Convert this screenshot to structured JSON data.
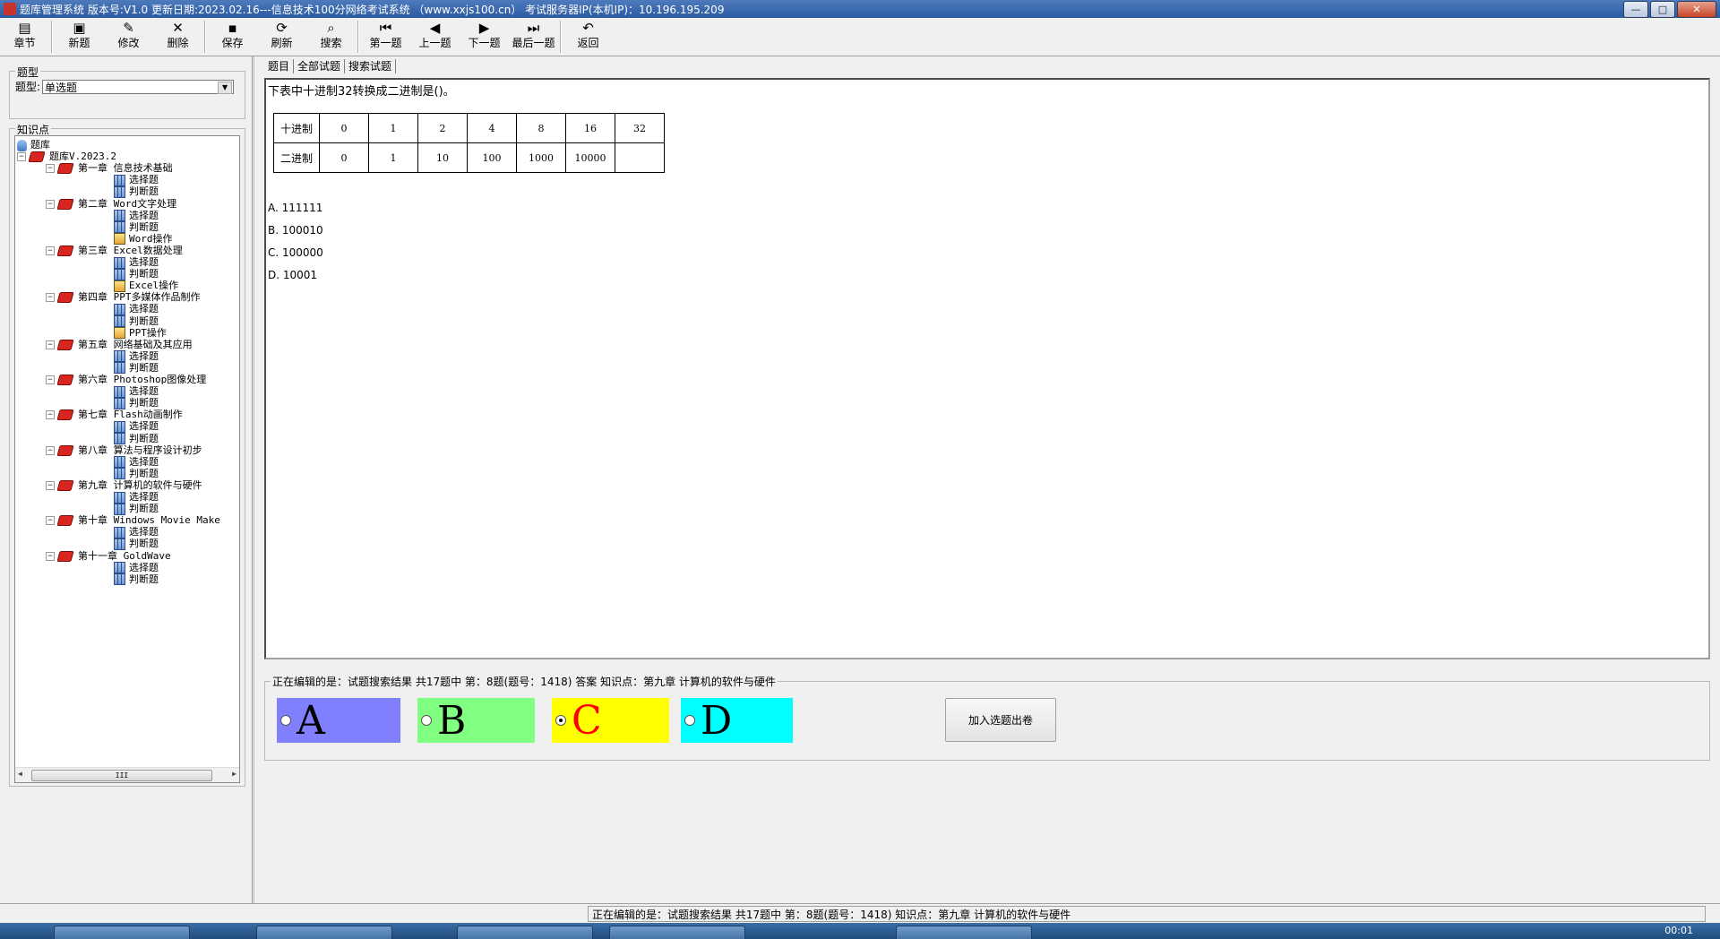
{
  "window": {
    "title": "题库管理系统 版本号:V1.0 更新日期:2023.02.16---信息技术100分网络考试系统 （www.xxjs100.cn）  考试服务器IP(本机IP)：10.196.195.209",
    "controls": {
      "minimize": "—",
      "maximize": "□",
      "close": "✕"
    }
  },
  "toolbar": {
    "buttons": [
      {
        "label": "章节",
        "icon": "chapter-icon",
        "glyph": "▤"
      },
      {
        "label": "新题",
        "icon": "new-icon",
        "glyph": "▣"
      },
      {
        "label": "修改",
        "icon": "edit-icon",
        "glyph": "✎"
      },
      {
        "label": "删除",
        "icon": "delete-icon",
        "glyph": "✕"
      },
      {
        "label": "保存",
        "icon": "save-icon",
        "glyph": "▪"
      },
      {
        "label": "刷新",
        "icon": "refresh-icon",
        "glyph": "⟳"
      },
      {
        "label": "搜索",
        "icon": "search-icon",
        "glyph": "⌕"
      },
      {
        "label": "第一题",
        "icon": "first-icon",
        "glyph": "⏮"
      },
      {
        "label": "上一题",
        "icon": "prev-icon",
        "glyph": "◀"
      },
      {
        "label": "下一题",
        "icon": "next-icon",
        "glyph": "▶"
      },
      {
        "label": "最后一题",
        "icon": "last-icon",
        "glyph": "⏭"
      },
      {
        "label": "返回",
        "icon": "back-icon",
        "glyph": "↶"
      }
    ]
  },
  "sidebar": {
    "type_group_title": "题型",
    "type_label": "题型:",
    "type_value": "单选题",
    "knowledge_group_title": "知识点",
    "tree": {
      "root": "题库",
      "bank": "题库V.2023.2",
      "chapters": [
        {
          "name": "第一章 信息技术基础",
          "children": [
            "选择题",
            "判断题"
          ]
        },
        {
          "name": "第二章 Word文字处理",
          "children": [
            "选择题",
            "判断题",
            "Word操作"
          ]
        },
        {
          "name": "第三章 Excel数据处理",
          "children": [
            "选择题",
            "判断题",
            "Excel操作"
          ]
        },
        {
          "name": "第四章 PPT多媒体作品制作",
          "children": [
            "选择题",
            "判断题",
            "PPT操作"
          ]
        },
        {
          "name": "第五章 网络基础及其应用",
          "children": [
            "选择题",
            "判断题"
          ]
        },
        {
          "name": "第六章 Photoshop图像处理",
          "children": [
            "选择题",
            "判断题"
          ]
        },
        {
          "name": "第七章 Flash动画制作",
          "children": [
            "选择题",
            "判断题"
          ]
        },
        {
          "name": "第八章 算法与程序设计初步",
          "children": [
            "选择题",
            "判断题"
          ]
        },
        {
          "name": "第九章 计算机的软件与硬件",
          "children": [
            "选择题",
            "判断题"
          ]
        },
        {
          "name": "第十章 Windows Movie Make",
          "children": [
            "选择题",
            "判断题"
          ]
        },
        {
          "name": "第十一章 GoldWave",
          "children": [
            "选择题",
            "判断题"
          ]
        }
      ]
    },
    "scroll_thumb": "III"
  },
  "tabs": [
    "题目",
    "全部试题",
    "搜索试题"
  ],
  "question": {
    "text": "下表中十进制32转换成二进制是()。",
    "table": [
      [
        "十进制",
        "0",
        "1",
        "2",
        "4",
        "8",
        "16",
        "32"
      ],
      [
        "二进制",
        "0",
        "1",
        "10",
        "100",
        "1000",
        "10000",
        ""
      ]
    ],
    "options": [
      "A. 111111",
      "B. 100010",
      "C. 100000",
      "D. 10001"
    ]
  },
  "answer": {
    "group_title": "正在编辑的是：试题搜索结果 共17题中  第：8题(题号：1418) 答案 知识点：第九章 计算机的软件与硬件",
    "choices": [
      {
        "letter": "A",
        "bg": "#8080ff",
        "color": "#000000",
        "selected": false
      },
      {
        "letter": "B",
        "bg": "#80ff80",
        "color": "#000000",
        "selected": false
      },
      {
        "letter": "C",
        "bg": "#ffff00",
        "color": "#ff0000",
        "selected": true
      },
      {
        "letter": "D",
        "bg": "#00ffff",
        "color": "#000000",
        "selected": false
      }
    ],
    "add_button": "加入选题出卷"
  },
  "status": {
    "text": "正在编辑的是：试题搜索结果 共17题中  第：8题(题号：1418)  知识点：第九章 计算机的软件与硬件"
  },
  "taskbar": {
    "clock": "00:01"
  }
}
